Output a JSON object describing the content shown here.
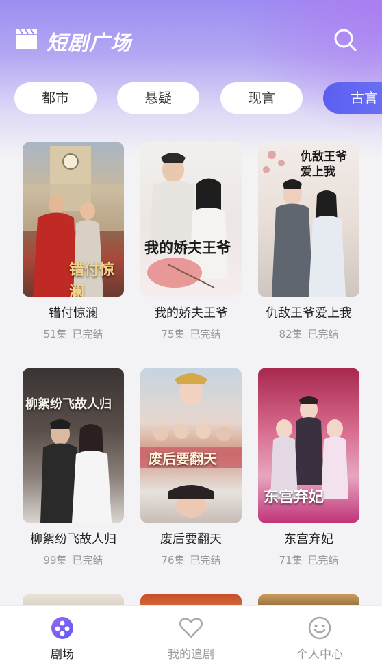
{
  "header": {
    "title": "短剧广场"
  },
  "categories": [
    {
      "label": "都市",
      "active": false
    },
    {
      "label": "悬疑",
      "active": false
    },
    {
      "label": "现言",
      "active": false
    },
    {
      "label": "古言",
      "active": true
    }
  ],
  "dramas": [
    {
      "name": "错付惊澜",
      "episodes": "51集",
      "status": "已完结",
      "poster_text": "错付惊澜"
    },
    {
      "name": "我的娇夫王爷",
      "episodes": "75集",
      "status": "已完结",
      "poster_text": "我的娇夫王爷"
    },
    {
      "name": "仇敌王爷爱上我",
      "episodes": "82集",
      "status": "已完结",
      "poster_text": "仇敌王爷爱上我"
    },
    {
      "name": "柳絮纷飞故人归",
      "episodes": "99集",
      "status": "已完结",
      "poster_text": "柳絮纷飞故人归"
    },
    {
      "name": "废后要翻天",
      "episodes": "76集",
      "status": "已完结",
      "poster_text": "废后要翻天"
    },
    {
      "name": "东宫弃妃",
      "episodes": "71集",
      "status": "已完结",
      "poster_text": "东宫弃妃"
    }
  ],
  "tabbar": {
    "tabs": [
      {
        "label": "剧场",
        "icon": "theater-icon",
        "active": true
      },
      {
        "label": "我的追剧",
        "icon": "heart-icon",
        "active": false
      },
      {
        "label": "个人中心",
        "icon": "smiley-icon",
        "active": false
      }
    ]
  },
  "colors": {
    "accent": "#5a5ff0",
    "header_gradient_top": "#9b8ef2"
  }
}
